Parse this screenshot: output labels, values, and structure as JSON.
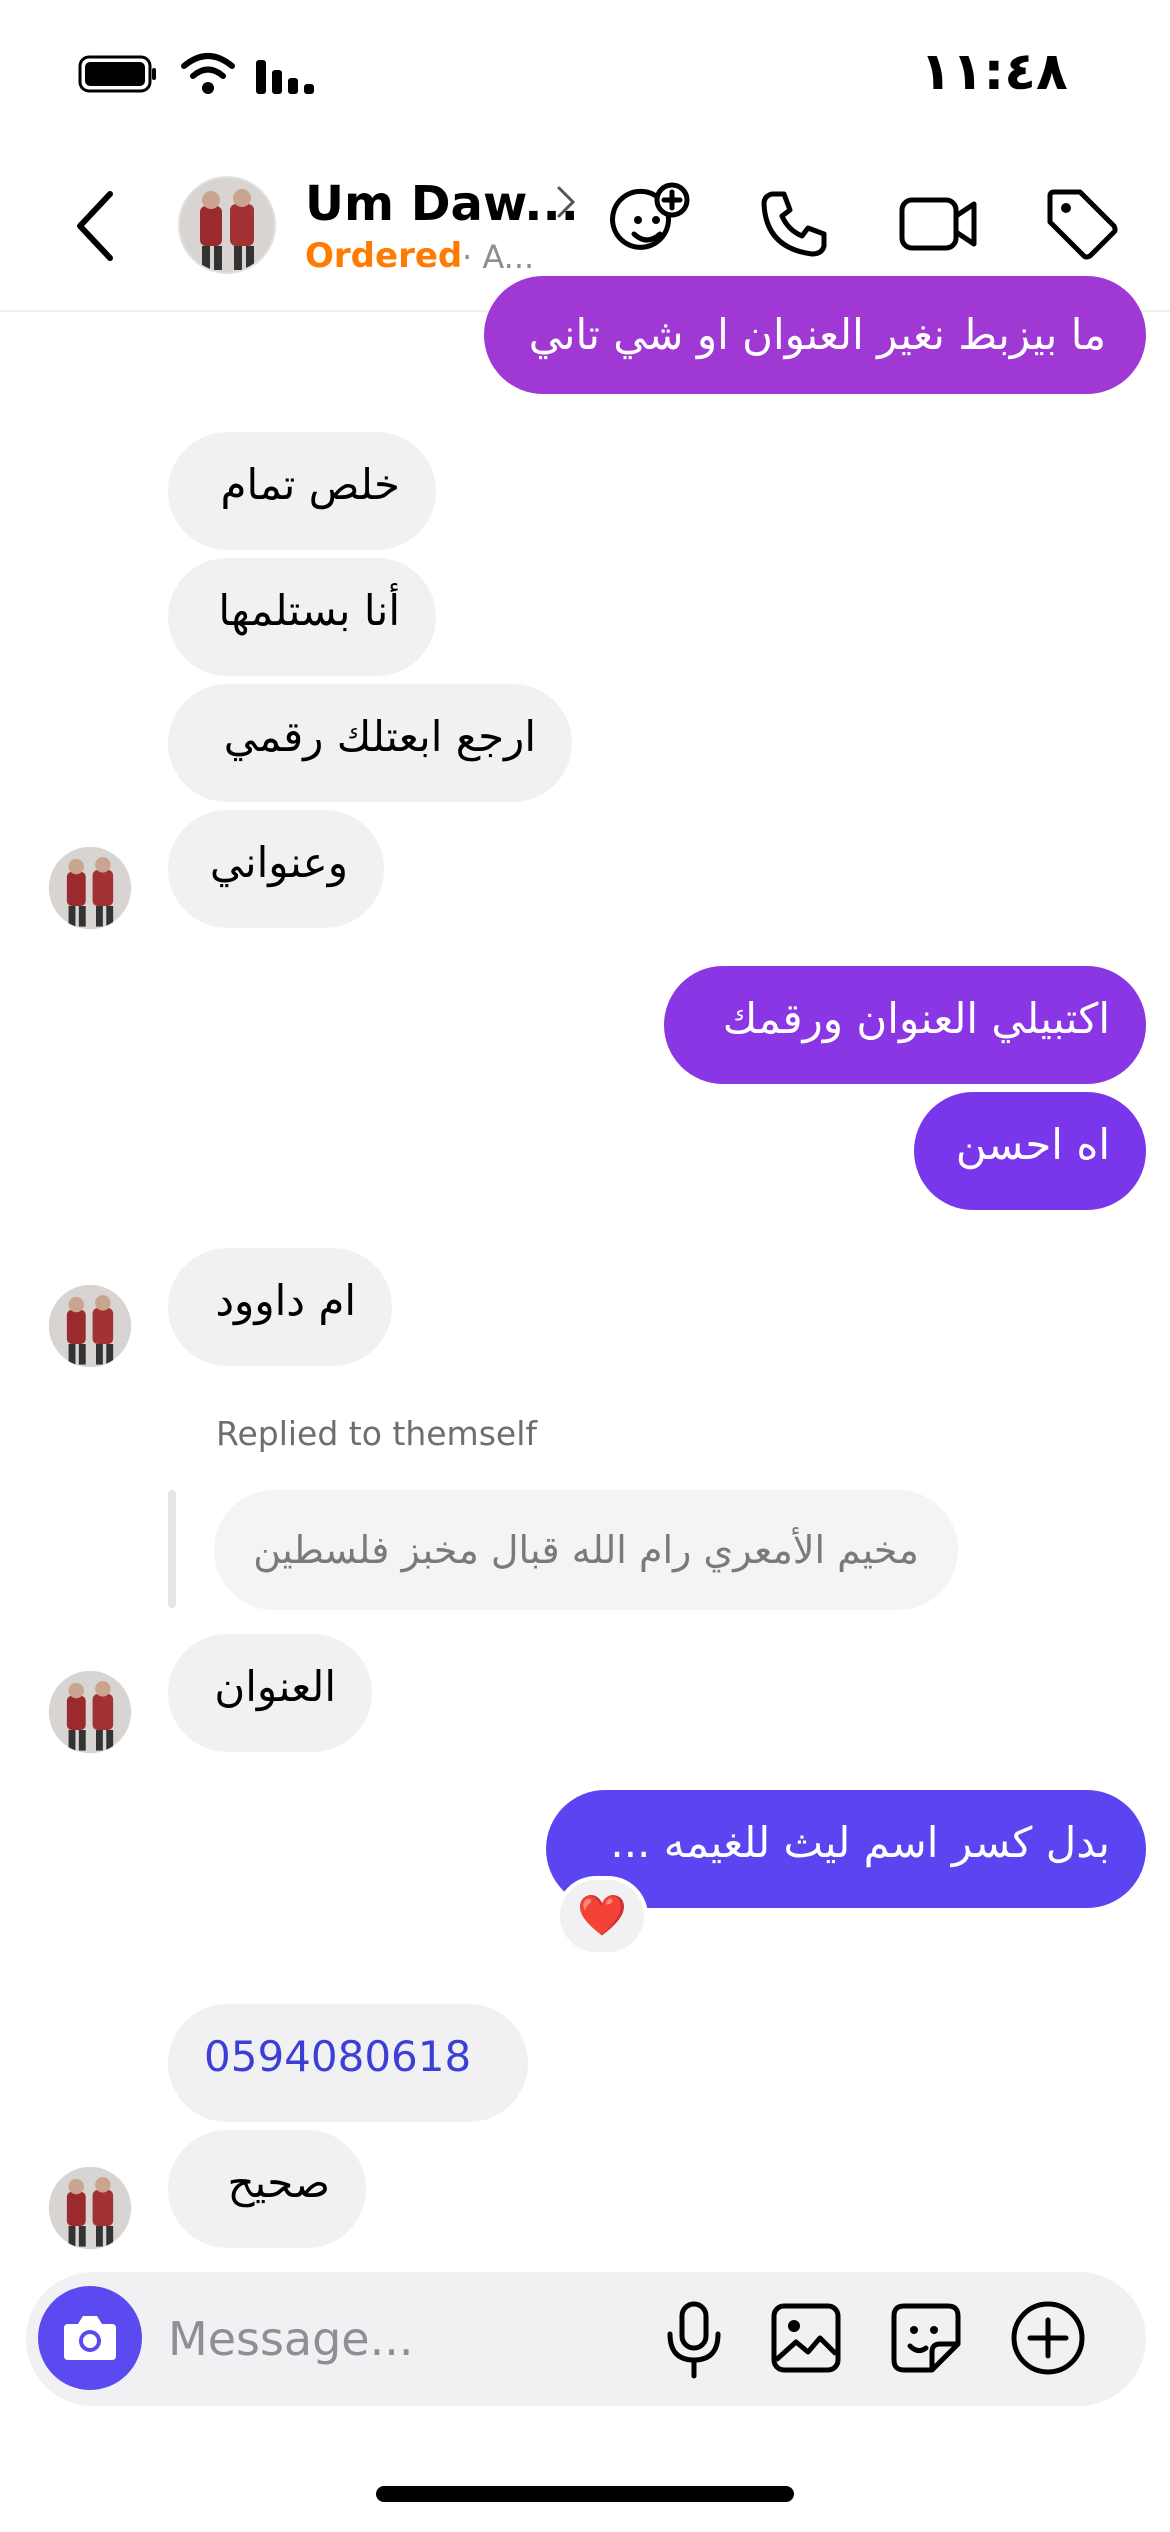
{
  "status_bar": {
    "time": "١١:٤٨"
  },
  "header": {
    "contact_name": "Um Daw...",
    "status": "Ordered",
    "sub": "· A...",
    "icons": [
      "back-icon",
      "avatar",
      "chevron-right-icon",
      "face-plus-icon",
      "phone-icon",
      "video-icon",
      "tag-icon"
    ]
  },
  "messages": [
    {
      "text": "ما بيزبط نغير العنوان او شي تاني",
      "sender": "me",
      "color": "#a039d4"
    },
    {
      "text": "خلص تمام",
      "sender": "them"
    },
    {
      "text": "أنا بستلمها",
      "sender": "them"
    },
    {
      "text": "ارجع ابعتلك رقمي",
      "sender": "them"
    },
    {
      "text": "وعنواني",
      "sender": "them"
    },
    {
      "text": "اكتبيلي العنوان ورقمك",
      "sender": "me",
      "color": "#8a36e4"
    },
    {
      "text": "اه احسن",
      "sender": "me",
      "color": "#7a36ea"
    },
    {
      "text": "ام داوود",
      "sender": "them"
    },
    {
      "text": "العنوان",
      "sender": "them"
    },
    {
      "text": "بدل كسر اسم ليث للغيمه ...",
      "sender": "me",
      "color": "#5a45f0"
    },
    {
      "text": "0594080618",
      "sender": "them",
      "link_color": "#3b3fd6"
    },
    {
      "text": "صحيح",
      "sender": "them"
    }
  ],
  "reply": {
    "label": "Replied to themself",
    "quote": "مخيم الأمعري رام الله قبال مخبز فلسطين"
  },
  "reaction": {
    "emoji": "❤️"
  },
  "composer": {
    "placeholder": "Message..."
  },
  "colors": {
    "accent": "#5b4af0",
    "ordered": "#ff7a00"
  }
}
